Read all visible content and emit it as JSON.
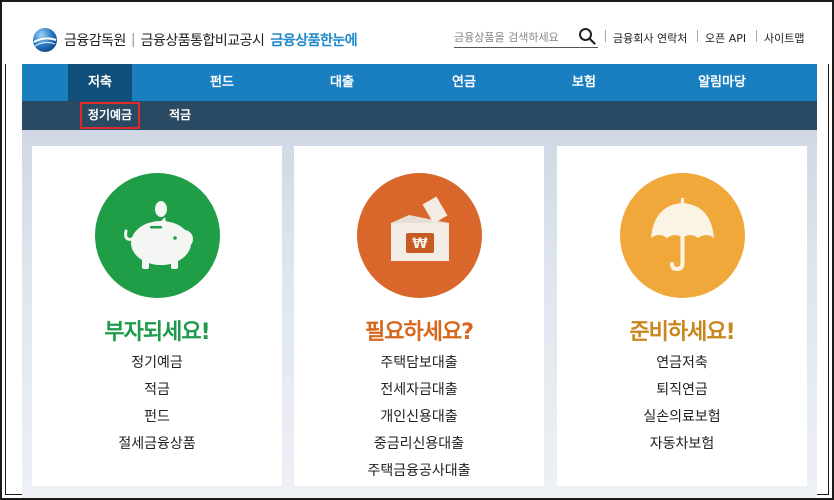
{
  "header": {
    "org_name": "금융감독원",
    "site_title": "금융상품통합비교공시",
    "brand": "금융상품한눈에",
    "search_placeholder": "금융상품을 검색하세요",
    "util_links": [
      "금융회사 연락처",
      "오픈 API",
      "사이트맵"
    ]
  },
  "nav": {
    "items": [
      "저축",
      "펀드",
      "대출",
      "연금",
      "보험",
      "알림마당"
    ],
    "active": "저축",
    "sub_items": [
      "정기예금",
      "적금"
    ],
    "selected_sub": "정기예금"
  },
  "cards": [
    {
      "title": "부자되세요!",
      "color": "#1e9a4a",
      "circle_color": "#1f9d47",
      "icon": "piggy-bank-icon",
      "links": [
        "정기예금",
        "적금",
        "펀드",
        "절세금융상품"
      ]
    },
    {
      "title": "필요하세요?",
      "color": "#d8661d",
      "circle_color": "#d9662a",
      "icon": "money-envelope-icon",
      "links": [
        "주택담보대출",
        "전세자금대출",
        "개인신용대출",
        "중금리신용대출",
        "주택금융공사대출"
      ]
    },
    {
      "title": "준비하세요!",
      "color": "#c8861c",
      "circle_color": "#f0a83a",
      "icon": "umbrella-icon",
      "links": [
        "연금저축",
        "퇴직연금",
        "실손의료보험",
        "자동차보험"
      ]
    }
  ],
  "colors": {
    "nav_bg": "#1a7fc1",
    "nav_active": "#0f4f7a",
    "subnav_bg": "#2a4a63",
    "selected_outline": "#e02a2a"
  }
}
